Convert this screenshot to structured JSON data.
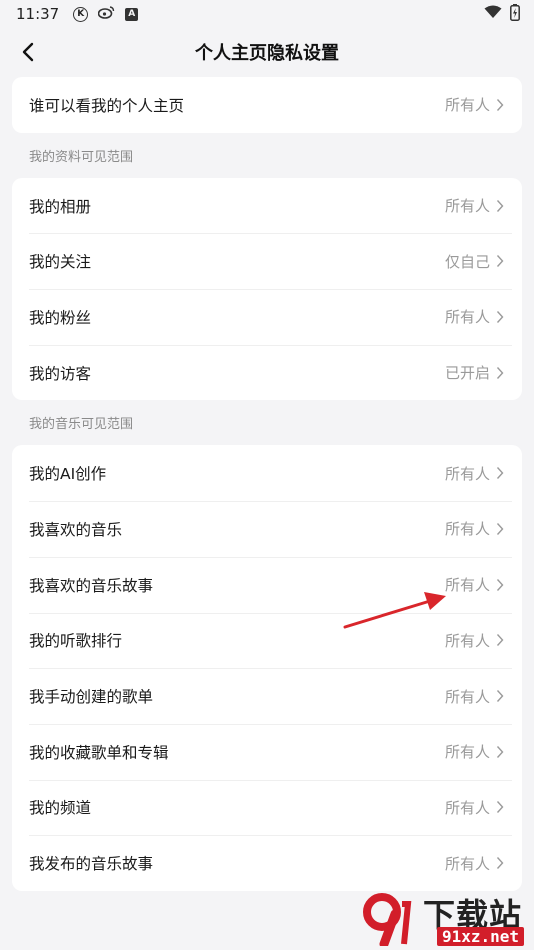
{
  "status_bar": {
    "time": "11:37",
    "icons": [
      "k-circle-icon",
      "weibo-icon",
      "a-square-icon"
    ],
    "k_label": "K",
    "a_label": "A",
    "right_icons": [
      "wifi-icon",
      "battery-icon"
    ]
  },
  "header": {
    "title": "个人主页隐私设置",
    "back_icon": "chevron-left-icon"
  },
  "homepage": {
    "items": [
      {
        "label": "谁可以看我的个人主页",
        "value": "所有人"
      }
    ]
  },
  "profile_section": {
    "title": "我的资料可见范围",
    "items": [
      {
        "label": "我的相册",
        "value": "所有人"
      },
      {
        "label": "我的关注",
        "value": "仅自己"
      },
      {
        "label": "我的粉丝",
        "value": "所有人"
      },
      {
        "label": "我的访客",
        "value": "已开启"
      }
    ]
  },
  "music_section": {
    "title": "我的音乐可见范围",
    "items": [
      {
        "label": "我的AI创作",
        "value": "所有人"
      },
      {
        "label": "我喜欢的音乐",
        "value": "所有人"
      },
      {
        "label": "我喜欢的音乐故事",
        "value": "所有人"
      },
      {
        "label": "我的听歌排行",
        "value": "所有人"
      },
      {
        "label": "我手动创建的歌单",
        "value": "所有人"
      },
      {
        "label": "我的收藏歌单和专辑",
        "value": "所有人"
      },
      {
        "label": "我的频道",
        "value": "所有人"
      },
      {
        "label": "我发布的音乐故事",
        "value": "所有人"
      }
    ]
  },
  "annotation": {
    "arrow_color": "#d9262b"
  },
  "watermark": {
    "title": "下载站",
    "url": "91xz.net",
    "logo_color": "#d21e2a"
  }
}
